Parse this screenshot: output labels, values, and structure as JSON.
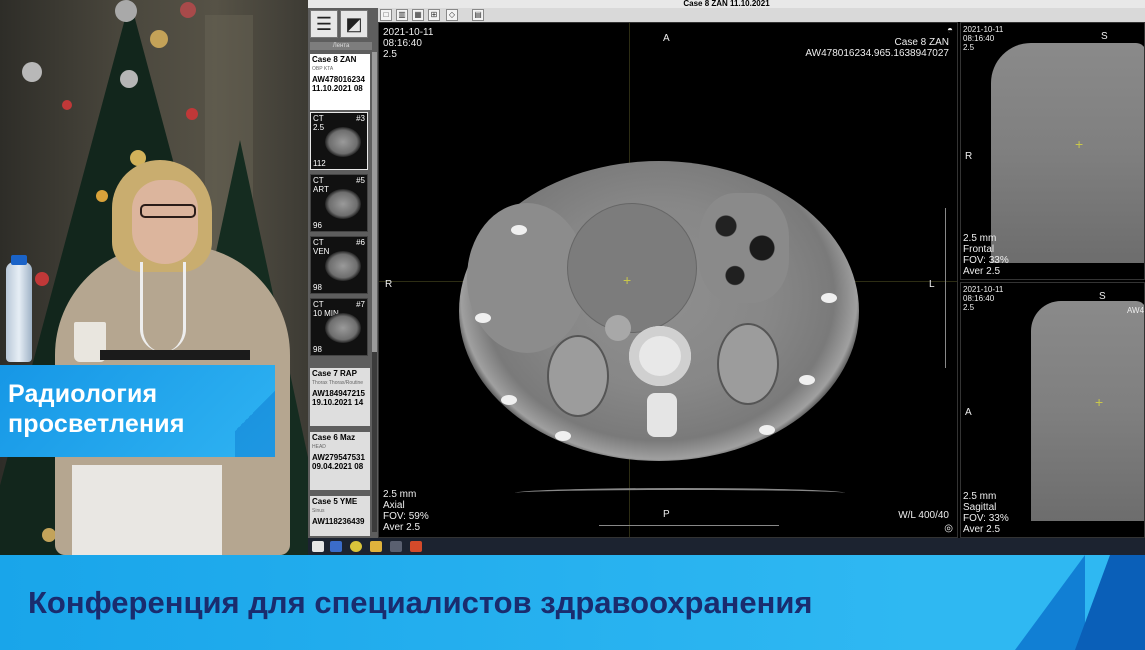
{
  "presenter_banner": {
    "line1": "Радиология",
    "line2": "просветления"
  },
  "viewer": {
    "title": "Case 8 ZAN  11.10.2021",
    "panel_tab": "Лента",
    "studies": [
      {
        "name": "Case 8 ZAN",
        "sub": "OBP KTA",
        "id": "AW478016234",
        "date": "11.10.2021 08"
      },
      {
        "name": "Case 7 RAP",
        "sub": "Thorax Thorax/Routine",
        "id": "AW184947215",
        "date": "19.10.2021 14"
      },
      {
        "name": "Case 6 Maz",
        "sub": "HEAD",
        "id": "AW279547531",
        "date": "09.04.2021 08"
      },
      {
        "name": "Case 5 YME",
        "sub": "Sinus",
        "id": "AW118236439",
        "date": ""
      }
    ],
    "series": [
      {
        "mod": "CT",
        "desc": "2.5",
        "num": "#3",
        "count": "112"
      },
      {
        "mod": "CT",
        "desc": "ART",
        "num": "#5",
        "count": "96"
      },
      {
        "mod": "CT",
        "desc": "VEN",
        "num": "#6",
        "count": "98"
      },
      {
        "mod": "CT",
        "desc": "10 MIN",
        "num": "#7",
        "count": "98"
      }
    ],
    "axial": {
      "date": "2021-10-11",
      "time": "08:16:40",
      "thickness_top": "2.5",
      "case": "Case 8 ZAN",
      "uid": "AW478016234.965.1638947027",
      "orient_top": "A",
      "orient_left": "R",
      "orient_right": "L",
      "orient_bottom": "P",
      "thickness": "2.5 mm",
      "plane": "Axial",
      "fov": "FOV: 59%",
      "aver": "Aver 2.5",
      "wl": "W/L 400/40"
    },
    "frontal": {
      "date": "2021-10-11",
      "time": "08:16:40",
      "thickness_top": "2.5",
      "orient_top": "S",
      "orient_left": "R",
      "thickness": "2.5 mm",
      "plane": "Frontal",
      "fov": "FOV: 33%",
      "aver": "Aver 2.5"
    },
    "sagittal": {
      "date": "2021-10-11",
      "time": "08:16:40",
      "thickness_top": "2.5",
      "orient_top": "S",
      "orient_left": "A",
      "case_short": "AW4",
      "thickness": "2.5 mm",
      "plane": "Sagittal",
      "fov": "FOV: 33%",
      "aver": "Aver 2.5"
    }
  },
  "bottom_banner": {
    "text": "Конференция для специалистов здравоохранения"
  },
  "colors": {
    "banner_blue": "#2fb8f2",
    "banner_text": "#1a2c6e",
    "crosshair": "#c9c74a"
  }
}
